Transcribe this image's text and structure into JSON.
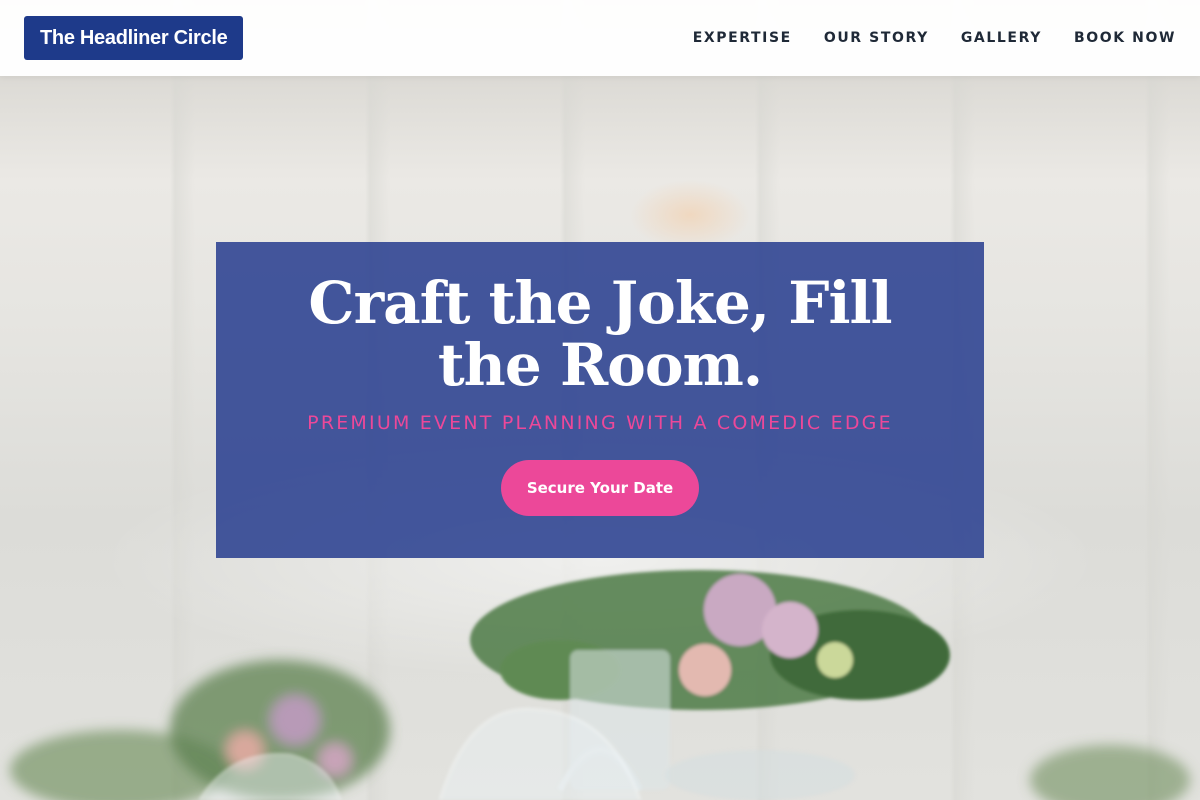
{
  "brand": {
    "name": "The Headliner Circle",
    "color": "#1e3a8a"
  },
  "nav": {
    "items": [
      {
        "label": "EXPERTISE"
      },
      {
        "label": "OUR STORY"
      },
      {
        "label": "GALLERY"
      },
      {
        "label": "BOOK NOW"
      }
    ]
  },
  "hero": {
    "headline": "Craft the Joke, Fill the Room.",
    "tagline": "PREMIUM EVENT PLANNING WITH A COMEDIC EDGE",
    "cta_label": "Secure Your Date",
    "background": "photo of a wedding reception table with floral centerpieces and wine glasses under a white marquee tent",
    "colors": {
      "card": "#2b4191",
      "accent": "#ec4899",
      "text": "#ffffff"
    }
  }
}
